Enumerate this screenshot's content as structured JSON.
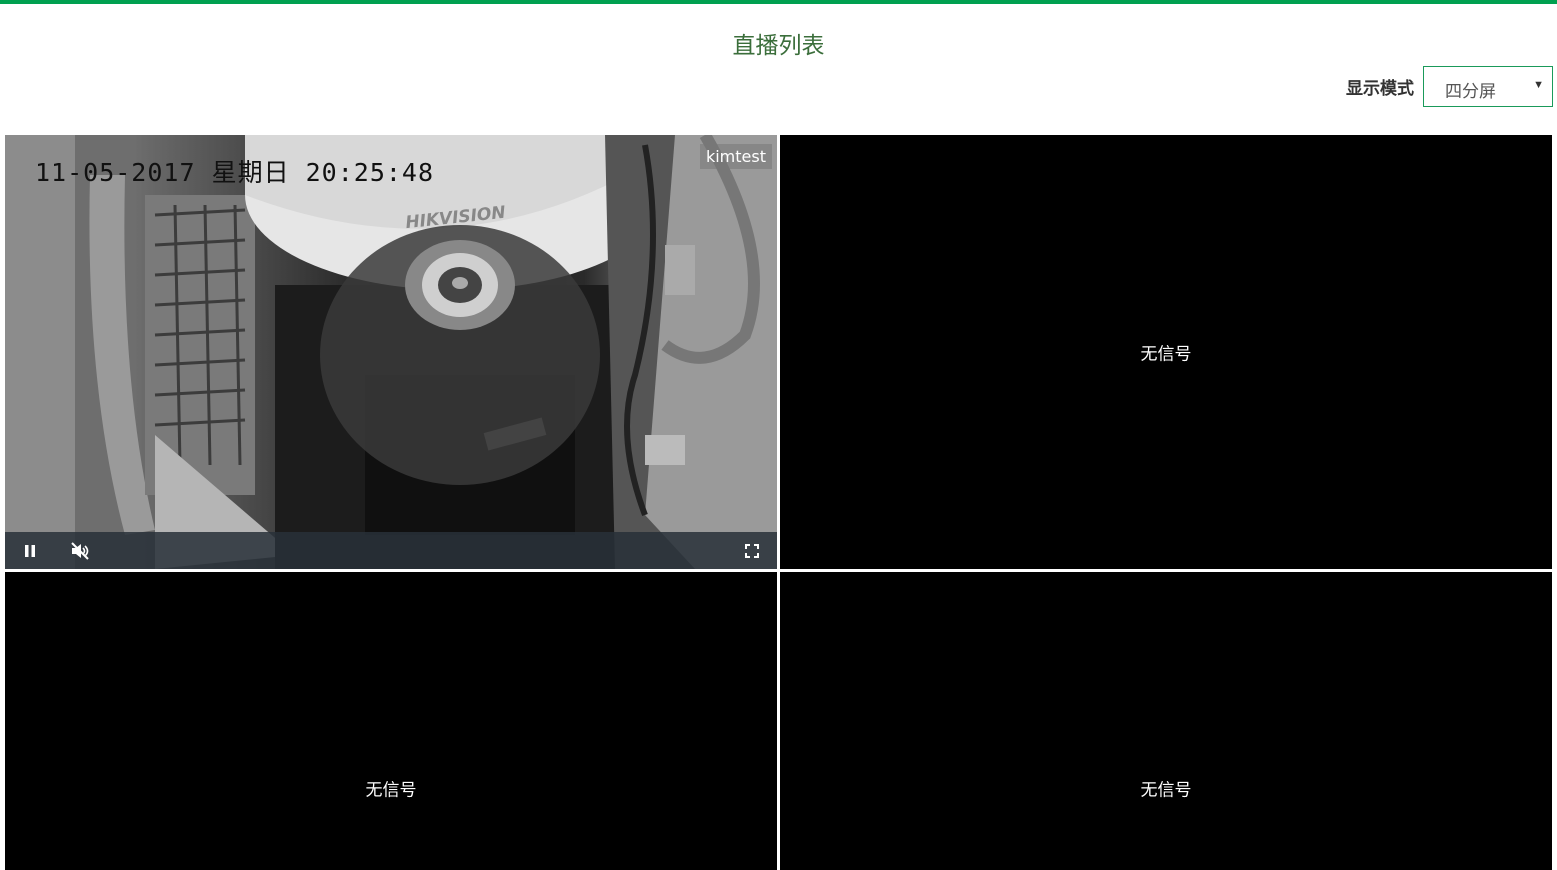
{
  "header": {
    "title": "直播列表"
  },
  "display_mode": {
    "label": "显示模式",
    "selected": "四分屏"
  },
  "player": {
    "osd_datetime": "11-05-2017 星期日 20:25:48",
    "camera_name": "kimtest",
    "brand_text": "HIKVISION"
  },
  "cells": [
    {
      "status": ""
    },
    {
      "status": "无信号"
    },
    {
      "status": "无信号"
    },
    {
      "status": "无信号"
    }
  ],
  "colors": {
    "accent": "#00a050",
    "title": "#3b6e3b"
  },
  "icons": [
    "pause-icon",
    "mute-icon",
    "fullscreen-icon",
    "dropdown-caret-icon"
  ]
}
